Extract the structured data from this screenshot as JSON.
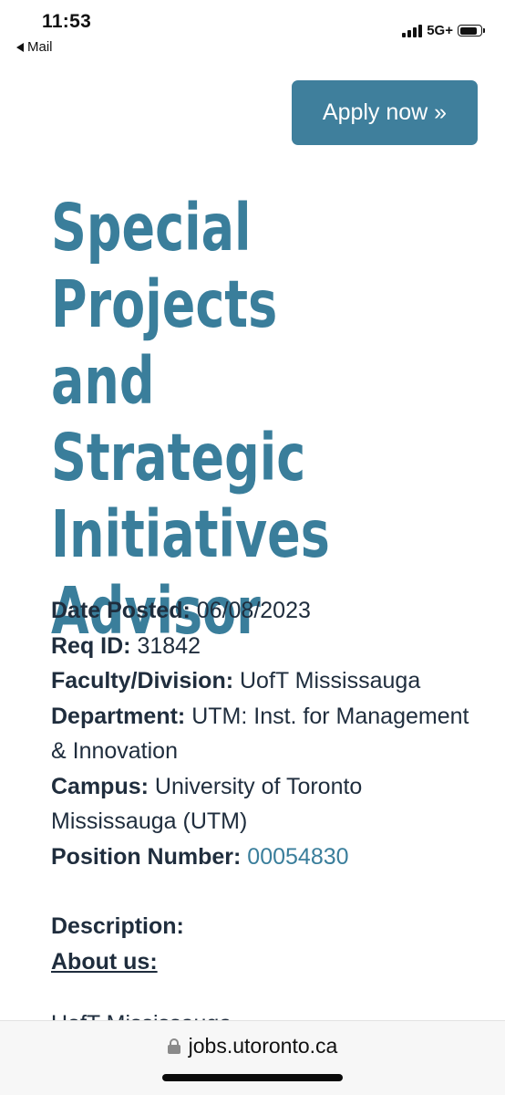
{
  "status_bar": {
    "time": "11:53",
    "back_label": "Mail",
    "network": "5G+",
    "icons": {
      "back": "back-triangle-icon",
      "signal": "cellular-signal-icon",
      "battery": "battery-icon"
    }
  },
  "header": {
    "apply_label": "Apply now »"
  },
  "job": {
    "title": "Special Projects and Strategic Initiatives Advisor",
    "date_posted_label": "Date Posted:",
    "date_posted_value": "06/08/2023",
    "req_id_label": "Req ID:",
    "req_id_value": "31842",
    "faculty_label": "Faculty/Division:",
    "faculty_value": "UofT Mississauga",
    "department_label": "Department:",
    "department_value": "UTM: Inst. for Management & Innovation",
    "campus_label": "Campus:",
    "campus_value": "University of Toronto Mississauga (UTM)",
    "position_label": "Position Number:",
    "position_value": "00054830",
    "description_heading": "Description:",
    "about_heading": "About us:",
    "cut_text": "UofT Mississauga..."
  },
  "browser": {
    "url": "jobs.utoronto.ca",
    "icons": {
      "lock": "lock-icon"
    }
  },
  "colors": {
    "accent": "#3a7e9b",
    "button": "#3f7f9c",
    "text": "#1f2d3d"
  }
}
